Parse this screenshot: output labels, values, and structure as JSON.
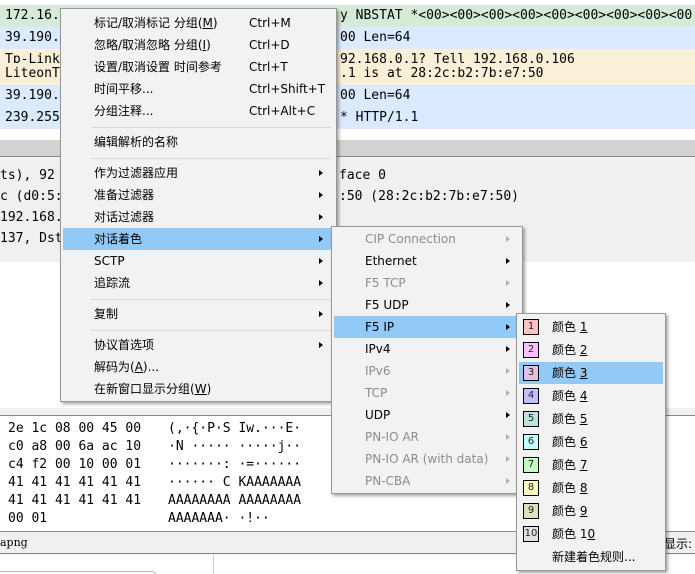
{
  "packet_list": {
    "rows": [
      {
        "left": "172.16.",
        "right": "y NBSTAT *<00><00><00><00><00><00><00><00><00",
        "bg": "#d5ebd7"
      },
      {
        "left": "39.190.",
        "right": "00 Len=64",
        "bg": "#dbeaff"
      },
      {
        "left": "Tp-Link",
        "right": "92.168.0.1? Tell 192.168.0.106",
        "bg": "#faf0d7"
      },
      {
        "left": "LiteonT",
        "right": ".1 is at 28:2c:b2:7b:e7:50",
        "bg": "#faf0d7"
      },
      {
        "left": "39.190.",
        "right": "00 Len=64",
        "bg": "#dbeaff"
      },
      {
        "left": "239.255",
        "right": "* HTTP/1.1",
        "bg": "#dbeaff"
      }
    ]
  },
  "details": {
    "rows": [
      {
        "left": "ts), 92",
        "right": "face 0"
      },
      {
        "left": "c (d0:5:",
        "right": ":50 (28:2c:b2:7b:e7:50)"
      },
      {
        "left": "192.168.",
        "right": ""
      },
      {
        "left": "137, Dst",
        "right": ""
      }
    ]
  },
  "bytes": {
    "rows": [
      {
        "hex": "2e 1c 08 00 45 00",
        "ascii": "(,·{·P·S Iw.···E·"
      },
      {
        "hex": "c0 a8 00 6a ac 10",
        "ascii": "·N ····· ·····j··"
      },
      {
        "hex": "c4 f2 00 10 00 01",
        "ascii": "·······: ·=······"
      },
      {
        "hex": "41 41 41 41 41 41",
        "ascii": "······ C KAAAAAAA"
      },
      {
        "hex": "41 41 41 41 41 41",
        "ascii": "AAAAAAAA AAAAAAAA"
      },
      {
        "hex": "00 01",
        "ascii": "AAAAAAA· ·!··"
      }
    ]
  },
  "statusbar": {
    "file": "apng",
    "display_label": "显示:"
  },
  "context_menu": {
    "items": [
      {
        "pre": "标记/取消标记 分组(",
        "u": "M",
        "post": ")",
        "shortcut": "Ctrl+M"
      },
      {
        "pre": "忽略/取消忽略 分组(",
        "u": "I",
        "post": ")",
        "shortcut": "Ctrl+D"
      },
      {
        "pre": "设置/取消设置 时间参考",
        "u": "",
        "post": "",
        "shortcut": "Ctrl+T"
      },
      {
        "pre": "时间平移...",
        "u": "",
        "post": "",
        "shortcut": "Ctrl+Shift+T"
      },
      {
        "pre": "分组注释...",
        "u": "",
        "post": "",
        "shortcut": "Ctrl+Alt+C"
      },
      {
        "pre": "编辑解析的名称",
        "u": "",
        "post": "",
        "shortcut": ""
      },
      {
        "pre": "作为过滤器应用",
        "u": "",
        "post": "",
        "shortcut": "",
        "submenu": true
      },
      {
        "pre": "准备过滤器",
        "u": "",
        "post": "",
        "shortcut": "",
        "submenu": true
      },
      {
        "pre": "对话过滤器",
        "u": "",
        "post": "",
        "shortcut": "",
        "submenu": true
      },
      {
        "pre": "对话着色",
        "u": "",
        "post": "",
        "shortcut": "",
        "submenu": true,
        "highlighted": true
      },
      {
        "pre": "SCTP",
        "u": "",
        "post": "",
        "shortcut": "",
        "submenu": true
      },
      {
        "pre": "追踪流",
        "u": "",
        "post": "",
        "shortcut": "",
        "submenu": true
      },
      {
        "pre": "复制",
        "u": "",
        "post": "",
        "shortcut": "",
        "submenu": true
      },
      {
        "pre": "协议首选项",
        "u": "",
        "post": "",
        "shortcut": "",
        "submenu": true
      },
      {
        "pre": "解码为(",
        "u": "A",
        "post": ")...",
        "shortcut": ""
      },
      {
        "pre": "在新窗口显示分组(",
        "u": "W",
        "post": ")",
        "shortcut": ""
      }
    ]
  },
  "colorize_submenu": {
    "items": [
      {
        "label": "CIP Connection",
        "enabled": false
      },
      {
        "label": "Ethernet",
        "enabled": true
      },
      {
        "label": "F5 TCP",
        "enabled": false
      },
      {
        "label": "F5 UDP",
        "enabled": true
      },
      {
        "label": "F5 IP",
        "enabled": true,
        "highlighted": true
      },
      {
        "label": "IPv4",
        "enabled": true
      },
      {
        "label": "IPv6",
        "enabled": false
      },
      {
        "label": "TCP",
        "enabled": false
      },
      {
        "label": "UDP",
        "enabled": true
      },
      {
        "label": "PN-IO AR",
        "enabled": false
      },
      {
        "label": "PN-IO AR (with data)",
        "enabled": false
      },
      {
        "label": "PN-CBA",
        "enabled": false
      }
    ]
  },
  "color_submenu": {
    "items": [
      {
        "num": "1",
        "pre": "颜色 ",
        "u": "1",
        "post": "",
        "color": "#ffc0c0"
      },
      {
        "num": "2",
        "pre": "颜色 ",
        "u": "2",
        "post": "",
        "color": "#ffc0ff"
      },
      {
        "num": "3",
        "pre": "颜色 ",
        "u": "3",
        "post": "",
        "color": "#e0c0e0",
        "highlighted": true
      },
      {
        "num": "4",
        "pre": "颜色 ",
        "u": "4",
        "post": "",
        "color": "#c0c0ff"
      },
      {
        "num": "5",
        "pre": "颜色 ",
        "u": "5",
        "post": "",
        "color": "#c0e0e0"
      },
      {
        "num": "6",
        "pre": "颜色 ",
        "u": "6",
        "post": "",
        "color": "#c0ffff"
      },
      {
        "num": "7",
        "pre": "颜色 ",
        "u": "7",
        "post": "",
        "color": "#c0ffc0"
      },
      {
        "num": "8",
        "pre": "颜色 ",
        "u": "8",
        "post": "",
        "color": "#ffffc0"
      },
      {
        "num": "9",
        "pre": "颜色 ",
        "u": "9",
        "post": "",
        "color": "#e0e0c0"
      },
      {
        "num": "10",
        "pre": "颜色 1",
        "u": "0",
        "post": "",
        "color": "#e0e0e0"
      }
    ],
    "new_rule": "新建着色规则..."
  }
}
